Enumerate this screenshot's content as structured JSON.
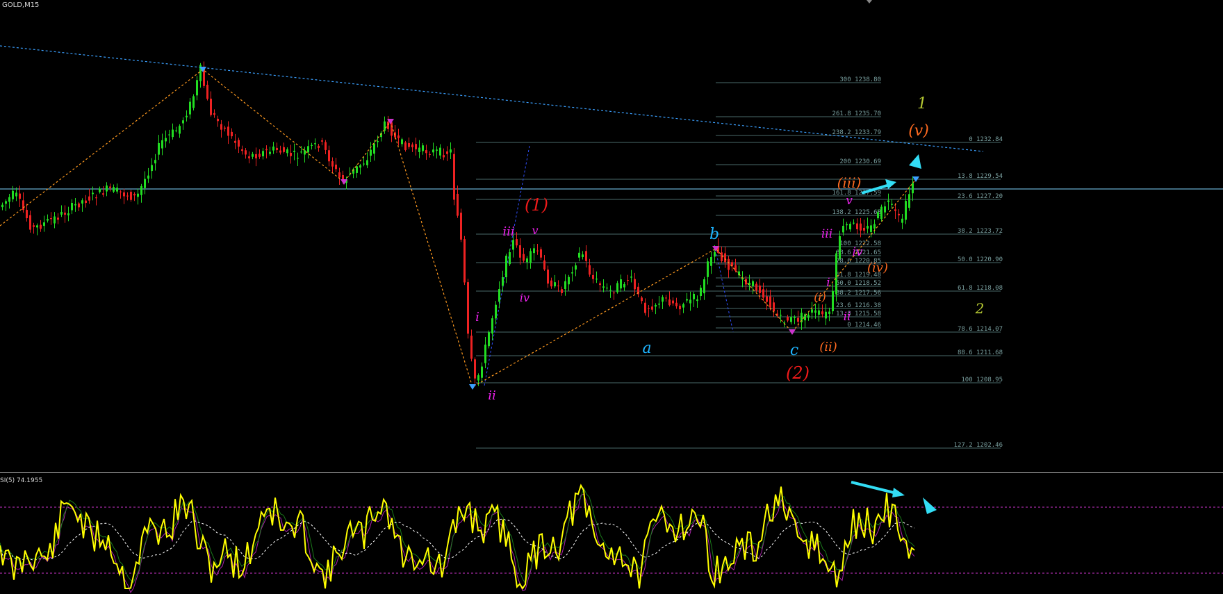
{
  "window": {
    "symbol": "GOLD,M15"
  },
  "indicator": {
    "label": "SI(5) 74.1955"
  },
  "colors": {
    "bull": "#22dd22",
    "bear": "#ee2222",
    "fib": "#4a6a6a",
    "trend": "#3ba0ff",
    "zigzag": "#ff9a20",
    "hline": "#7fd6ff",
    "rsi": "#ffff00",
    "arrow": "#33ddf5"
  },
  "chart_data": {
    "type": "candlestick",
    "series_note": "",
    "fib_right": [
      {
        "level": "0",
        "price": "1232.84"
      },
      {
        "level": "13.8",
        "price": "1229.54"
      },
      {
        "level": "23.6",
        "price": "1227.20"
      },
      {
        "level": "38.2",
        "price": "1223.72"
      },
      {
        "level": "50.0",
        "price": "1220.90"
      },
      {
        "level": "61.8",
        "price": "1218.08"
      },
      {
        "level": "78.6",
        "price": "1214.07"
      },
      {
        "level": "88.6",
        "price": "1211.68"
      },
      {
        "level": "100",
        "price": "1208.95"
      },
      {
        "level": "127.2",
        "price": "1202.46"
      }
    ],
    "fib_mid": [
      {
        "level": "300",
        "price": "1238.80"
      },
      {
        "level": "261.8",
        "price": "1235.70"
      },
      {
        "level": "238.2",
        "price": "1233.79"
      },
      {
        "level": "200",
        "price": "1230.69"
      },
      {
        "level": "161.8",
        "price": "1227.59"
      },
      {
        "level": "138.2",
        "price": "1225.68"
      },
      {
        "level": "100",
        "price": "1222.58"
      },
      {
        "level": "88.6",
        "price": "1221.65"
      },
      {
        "level": "78.6",
        "price": "1220.85"
      },
      {
        "level": "61.8",
        "price": "1219.48"
      },
      {
        "level": "50.0",
        "price": "1218.52"
      },
      {
        "level": "38.2",
        "price": "1217.56"
      },
      {
        "level": "23.6",
        "price": "1216.38"
      },
      {
        "level": "13.8",
        "price": "1215.58"
      },
      {
        "level": "0",
        "price": "1214.46"
      }
    ],
    "wave_labels": [
      {
        "text": "1",
        "color": "#b5c832"
      },
      {
        "text": "2",
        "color": "#b5c832"
      },
      {
        "text": "(v)",
        "color": "#ff6a20"
      },
      {
        "text": "(iii)",
        "color": "#ff6a20"
      },
      {
        "text": "(iv)",
        "color": "#ff6a20"
      },
      {
        "text": "(i)",
        "color": "#ff6a20"
      },
      {
        "text": "(ii)",
        "color": "#ff6a20"
      },
      {
        "text": "(1)",
        "color": "#ee1a1a"
      },
      {
        "text": "(2)",
        "color": "#ee1a1a"
      },
      {
        "text": "iii",
        "color": "#ee22ee"
      },
      {
        "text": "v",
        "color": "#ee22ee"
      },
      {
        "text": "iv",
        "color": "#ee22ee"
      },
      {
        "text": "i",
        "color": "#ee22ee"
      },
      {
        "text": "ii",
        "color": "#ee22ee"
      },
      {
        "text": "iii",
        "color": "#ee22ee"
      },
      {
        "text": "v",
        "color": "#ee22ee"
      },
      {
        "text": "iv",
        "color": "#ee22ee"
      },
      {
        "text": "i",
        "color": "#ee22ee"
      },
      {
        "text": "ii",
        "color": "#ee22ee"
      },
      {
        "text": "a",
        "color": "#1eb4ff"
      },
      {
        "text": "b",
        "color": "#1eb4ff"
      },
      {
        "text": "c",
        "color": "#1eb4ff"
      }
    ]
  }
}
